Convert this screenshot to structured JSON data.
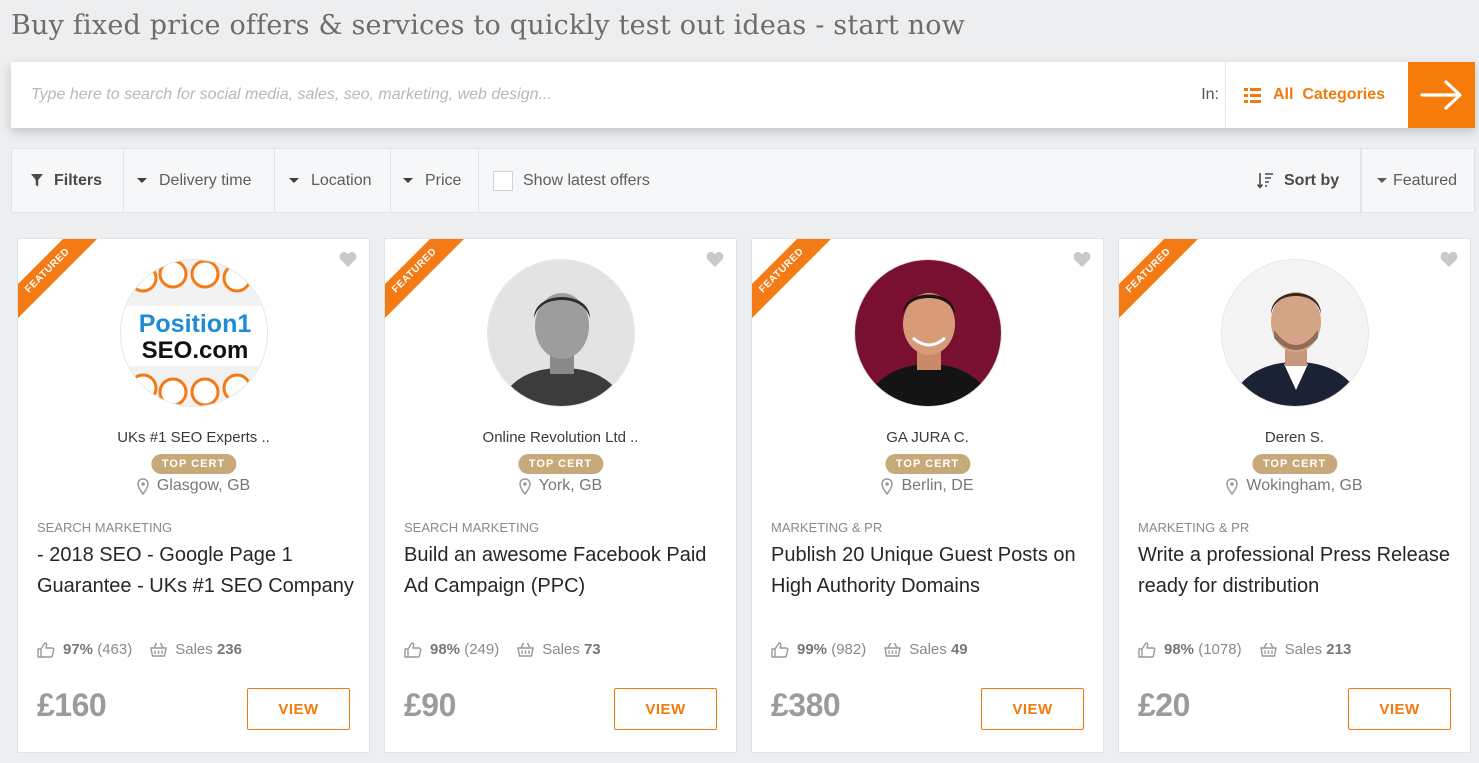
{
  "headline": "Buy fixed price offers & services to quickly test out ideas - start now",
  "search": {
    "placeholder": "Type here to search for social media, sales, seo, marketing, web design...",
    "in_label": "In:",
    "category_label": "All  Categories"
  },
  "filters": {
    "filters_label": "Filters",
    "delivery_label": "Delivery time",
    "location_label": "Location",
    "price_label": "Price",
    "latest_label": "Show latest offers",
    "sort_label": "Sort by",
    "sort_value": "Featured"
  },
  "colors": {
    "accent": "#f57c0b",
    "badge": "#c8a97a"
  },
  "cards": [
    {
      "ribbon": "FEATURED",
      "seller": "UKs #1 SEO Experts ..",
      "badge": "TOP CERT",
      "location": "Glasgow, GB",
      "category": "SEARCH MARKETING",
      "title": "- 2018 SEO - Google Page 1 Guarantee - UKs #1 SEO Company",
      "rating": "97%",
      "reviews": "(463)",
      "sales_label": "Sales",
      "sales": "236",
      "price": "£160",
      "button": "VIEW",
      "avatar_logo_line1": "Position1",
      "avatar_logo_line2": "SEO.com"
    },
    {
      "ribbon": "FEATURED",
      "seller": "Online Revolution Ltd ..",
      "badge": "TOP CERT",
      "location": "York, GB",
      "category": "SEARCH MARKETING",
      "title": "Build an awesome Facebook Paid Ad Campaign (PPC)",
      "rating": "98%",
      "reviews": "(249)",
      "sales_label": "Sales",
      "sales": "73",
      "price": "£90",
      "button": "VIEW"
    },
    {
      "ribbon": "FEATURED",
      "seller": "GA JURA C.",
      "badge": "TOP CERT",
      "location": "Berlin, DE",
      "category": "MARKETING & PR",
      "title": "Publish 20 Unique Guest Posts on High Authority Domains",
      "rating": "99%",
      "reviews": "(982)",
      "sales_label": "Sales",
      "sales": "49",
      "price": "£380",
      "button": "VIEW"
    },
    {
      "ribbon": "FEATURED",
      "seller": "Deren S.",
      "badge": "TOP CERT",
      "location": "Wokingham, GB",
      "category": "MARKETING & PR",
      "title": "Write a professional Press Release ready for distribution",
      "rating": "98%",
      "reviews": "(1078)",
      "sales_label": "Sales",
      "sales": "213",
      "price": "£20",
      "button": "VIEW"
    }
  ]
}
